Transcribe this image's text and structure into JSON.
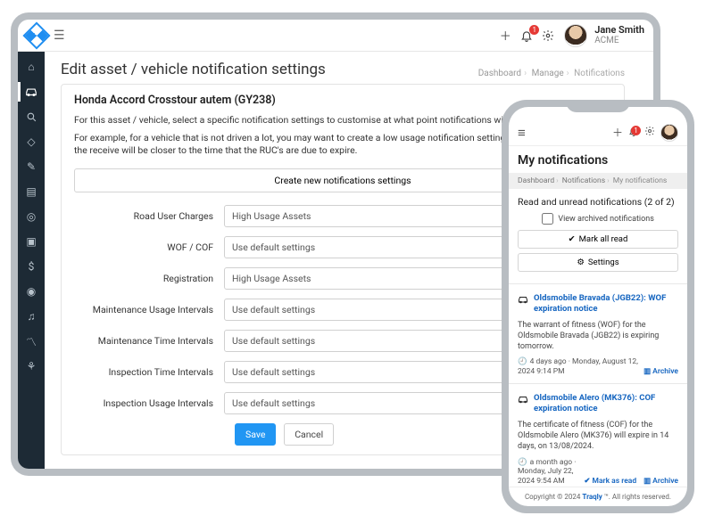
{
  "tablet": {
    "header": {
      "notif_badge": "1",
      "user": {
        "name": "Jane Smith",
        "org": "ACME"
      }
    },
    "title": "Edit asset / vehicle notification settings",
    "breadcrumbs": {
      "a": "Dashboard",
      "b": "Manage",
      "c": "Notifications"
    },
    "card": {
      "asset": "Honda Accord Crosstour autem (GY238)",
      "p1": "For this asset / vehicle, select a specific notification settings to customise at what point notifications will be sent.",
      "p2": "For example, for a vehicle that is not driven a lot, you may want to create a low usage notification setting for road user charges so the receive will be closer to the time that the RUC's are due to expire.",
      "create_btn": "Create new notifications settings",
      "opts": {
        "high": "High Usage Assets",
        "def": "Use default settings"
      },
      "rows": {
        "r1": "Road User Charges",
        "r2": "WOF / COF",
        "r3": "Registration",
        "r4": "Maintenance Usage Intervals",
        "r5": "Maintenance Time Intervals",
        "r6": "Inspection Time Intervals",
        "r7": "Inspection Usage Intervals"
      },
      "save": "Save",
      "cancel": "Cancel"
    }
  },
  "phone": {
    "header": {
      "notif_badge": "1"
    },
    "title": "My notifications",
    "breadcrumbs": {
      "a": "Dashboard",
      "b": "Notifications",
      "c": "My notifications"
    },
    "section_head": "Read and unread notifications (2 of 2)",
    "view_archived": "View archived notifications",
    "mark_all": "Mark all read",
    "settings": "Settings",
    "notifs": [
      {
        "title": "Oldsmobile Bravada (JGB22): WOF expiration notice",
        "body": "The warrant of fitness (WOF) for the Oldsmobile Bravada (JGB22) is expiring tomorrow.",
        "time_rel": "4 days ago",
        "time_abs": "Monday, August 12, 2024 9:14 PM",
        "archive": "Archive"
      },
      {
        "title": "Oldsmobile Alero (MK376): COF expiration notice",
        "body": "The certificate of fitness (COF) for the Oldsmobile Alero (MK376) will expire in 14 days, on 13/08/2024.",
        "time_rel": "a month ago",
        "time_abs": "Monday, July 22, 2024 9:54 AM",
        "mark_read": "Mark as read",
        "archive": "Archive"
      }
    ],
    "footer": {
      "pre": "Copyright © 2024 ",
      "brand": "Traqly",
      "tm": " ™.",
      "post": " All rights reserved."
    }
  }
}
